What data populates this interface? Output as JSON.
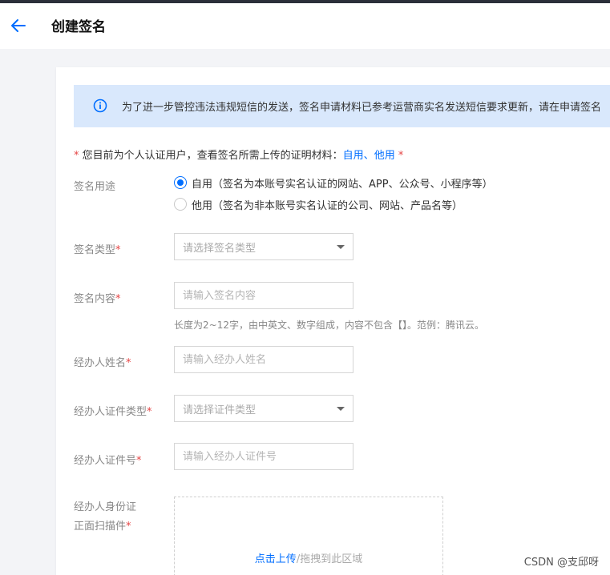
{
  "header": {
    "title": "创建签名"
  },
  "notice": {
    "text": "为了进一步管控违法违规短信的发送，签名申请材料已参考运营商实名发送短信要求更新，请在申请签名"
  },
  "tip": {
    "prefix": "您目前为个人认证用户，查看签名所需上传的证明材料：",
    "link_self": "自用",
    "separator": "、",
    "link_other": "他用"
  },
  "form": {
    "purpose": {
      "label": "签名用途",
      "options": [
        {
          "label": "自用（签名为本账号实名认证的网站、APP、公众号、小程序等）",
          "selected": true
        },
        {
          "label": "他用（签名为非本账号实名认证的公司、网站、产品名等）",
          "selected": false
        }
      ]
    },
    "sign_type": {
      "label": "签名类型",
      "placeholder": "请选择签名类型"
    },
    "sign_content": {
      "label": "签名内容",
      "placeholder": "请输入签名内容",
      "hint": "长度为2~12字，由中英文、数字组成，内容不包含【】。范例：腾讯云。"
    },
    "operator_name": {
      "label": "经办人姓名",
      "placeholder": "请输入经办人姓名"
    },
    "id_type": {
      "label": "经办人证件类型",
      "placeholder": "请选择证件类型"
    },
    "id_number": {
      "label": "经办人证件号",
      "placeholder": "请输入经办人证件号"
    },
    "id_scan": {
      "label_line1": "经办人身份证",
      "label_line2": "正面扫描件",
      "upload_link": "点击上传",
      "upload_text": "/拖拽到此区域"
    }
  },
  "required_mark": "*",
  "watermark": "CSDN @支邱呀",
  "colors": {
    "accent": "#006eff",
    "required": "#e54545",
    "notice_bg": "#d9e8fc"
  }
}
